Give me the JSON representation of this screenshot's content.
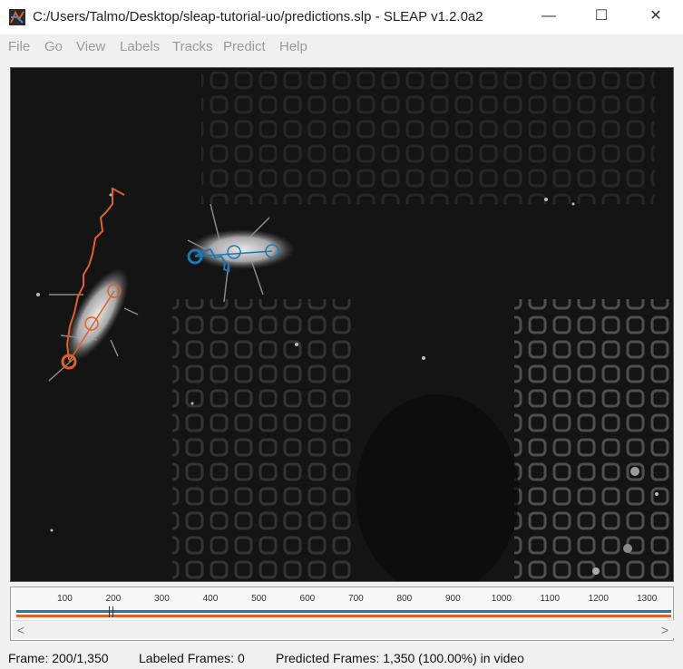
{
  "window": {
    "title": "C:/Users/Talmo/Desktop/sleap-tutorial-uo/predictions.slp - SLEAP v1.2.0a2",
    "controls": {
      "minimize": "—",
      "maximize": "☐",
      "close": "✕"
    }
  },
  "menu": [
    "File",
    "Go",
    "View",
    "Labels",
    "Tracks",
    "Predict",
    "Help"
  ],
  "viewer": {
    "instances": [
      {
        "track_color": "#e0602a",
        "icon": "orange-instance-skeleton"
      },
      {
        "track_color": "#1f77b4",
        "icon": "blue-instance-skeleton"
      }
    ]
  },
  "timeline": {
    "ticks": [
      "100",
      "200",
      "300",
      "400",
      "500",
      "600",
      "700",
      "800",
      "900",
      "1000",
      "1100",
      "1200",
      "1300"
    ],
    "current_frame": 200,
    "total_frames": 1350,
    "track_colors": [
      "#1f77b4",
      "#e0602a"
    ],
    "scroll_left": "<",
    "scroll_right": ">"
  },
  "status": {
    "frame": "Frame: 200/1,350",
    "labeled": "Labeled Frames: 0",
    "predicted": "Predicted Frames: 1,350 (100.00%) in video"
  }
}
